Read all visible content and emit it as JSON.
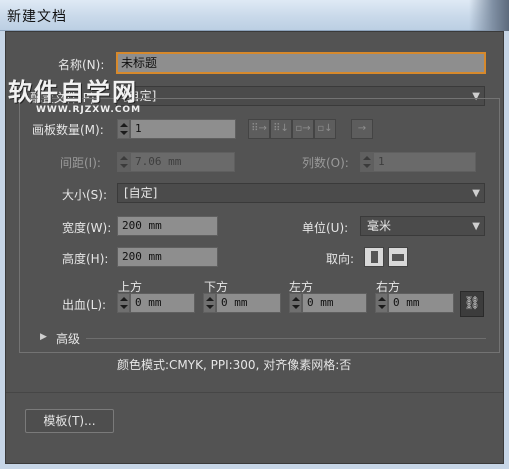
{
  "window": {
    "title": "新建文档"
  },
  "name": {
    "label": "名称(N):",
    "value": "未标题"
  },
  "profile": {
    "label": "配置文件(P):",
    "value": "[自定]"
  },
  "artboards": {
    "count_label": "画板数量(M):",
    "count_value": "1",
    "spacing_label": "间距(I):",
    "spacing_value": "7.06 mm",
    "columns_label": "列数(O):",
    "columns_value": "1"
  },
  "size": {
    "label": "大小(S):",
    "value": "[自定]"
  },
  "width": {
    "label": "宽度(W):",
    "value": "200 mm"
  },
  "units": {
    "label": "单位(U):",
    "value": "毫米"
  },
  "height": {
    "label": "高度(H):",
    "value": "200 mm"
  },
  "orientation": {
    "label": "取向:"
  },
  "bleed": {
    "label": "出血(L):",
    "top_label": "上方",
    "top_value": "0 mm",
    "bottom_label": "下方",
    "bottom_value": "0 mm",
    "left_label": "左方",
    "left_value": "0 mm",
    "right_label": "右方",
    "right_value": "0 mm"
  },
  "advanced": {
    "label": "高级",
    "toggle_glyph": "▶"
  },
  "info": {
    "text": "颜色模式:CMYK, PPI:300, 对齐像素网格:否"
  },
  "buttons": {
    "templates_label": "模板(T)..."
  },
  "watermark": {
    "big": "软件自学网",
    "small": "WWW.RJZXW.COM"
  },
  "glyphs": {
    "dropdown_arrow": "▼",
    "link": "⛓",
    "arrow_right": "→",
    "grid_row": "⠿→",
    "grid_col": "⠿↓",
    "row_arrow": "▫→",
    "col_arrow": "▫↓"
  }
}
